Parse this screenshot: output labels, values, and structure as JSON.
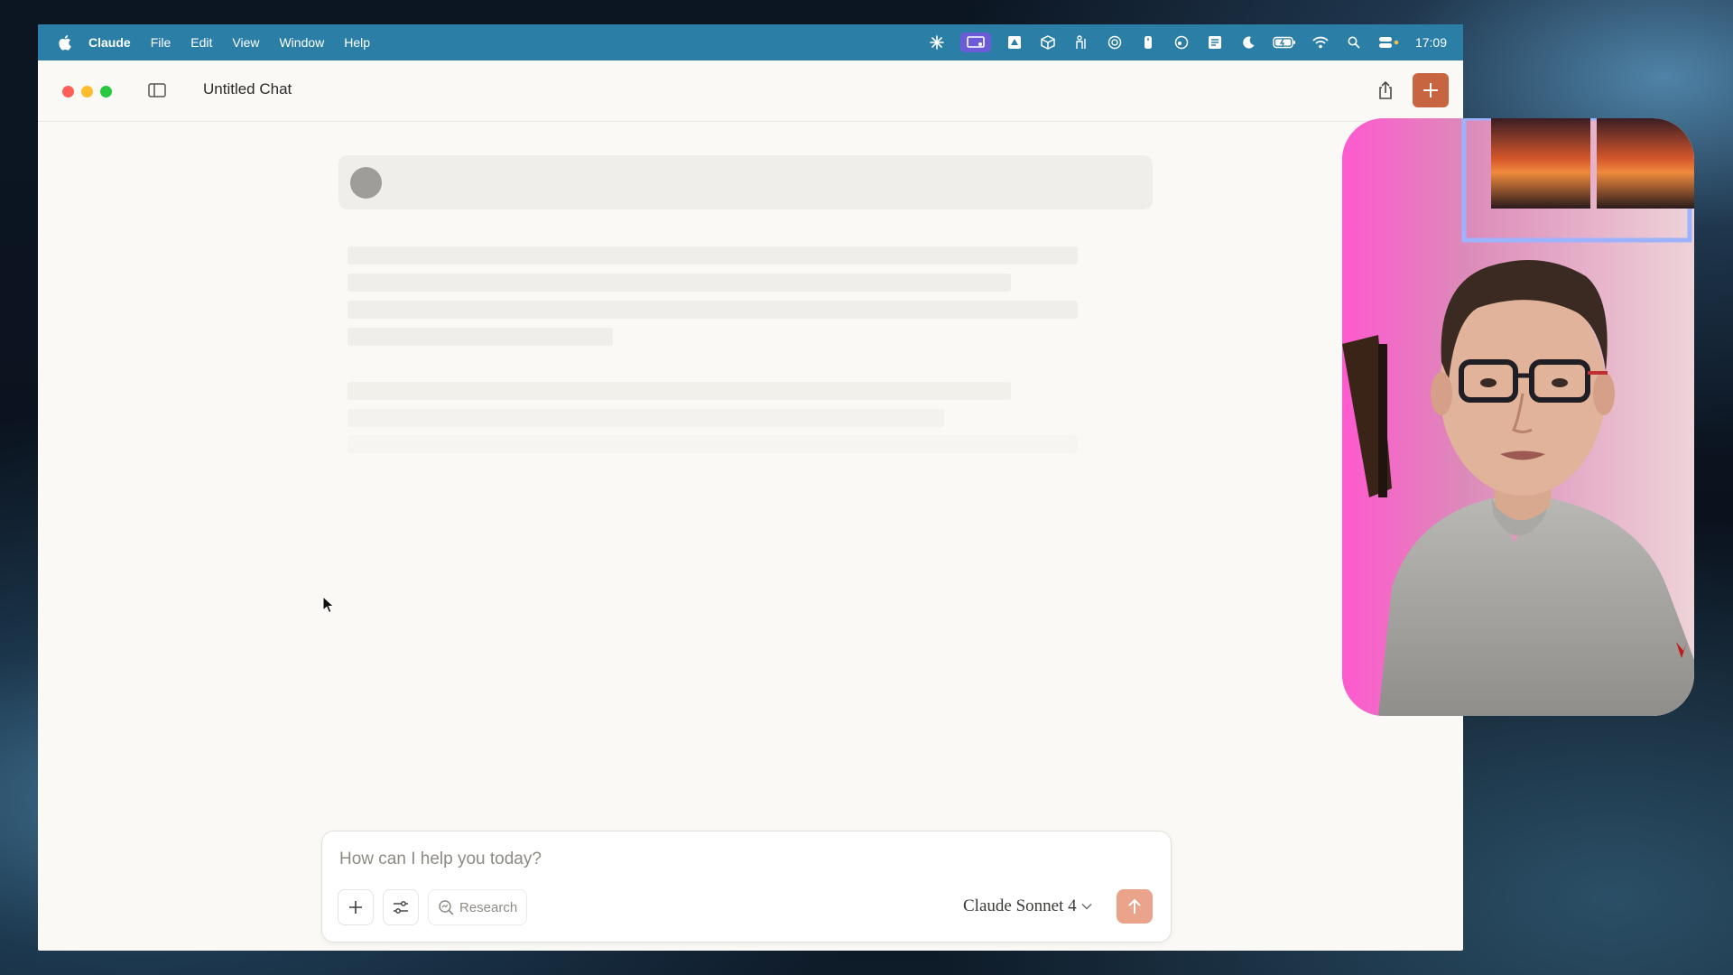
{
  "menubar": {
    "app_name": "Claude",
    "menus": [
      "File",
      "Edit",
      "View",
      "Window",
      "Help"
    ],
    "status_icons": [
      "claude-spark-icon",
      "screen-share-icon",
      "drive-icon",
      "package-icon",
      "figure-icon",
      "timer-icon",
      "pen-icon",
      "chat-bubble-icon",
      "stack-icon",
      "moon-icon",
      "battery-icon",
      "wifi-icon",
      "spotlight-search-icon",
      "control-center-icon"
    ],
    "clock": "17:09"
  },
  "titlebar": {
    "title": "Untitled Chat"
  },
  "composer": {
    "placeholder": "How can I help you today?",
    "research_label": "Research",
    "model_name": "Claude Sonnet 4"
  },
  "colors": {
    "menubar_bg": "#2b7fa7",
    "accent": "#c8643f",
    "send_disabled": "#e9a48b",
    "window_bg": "#faf9f6"
  }
}
